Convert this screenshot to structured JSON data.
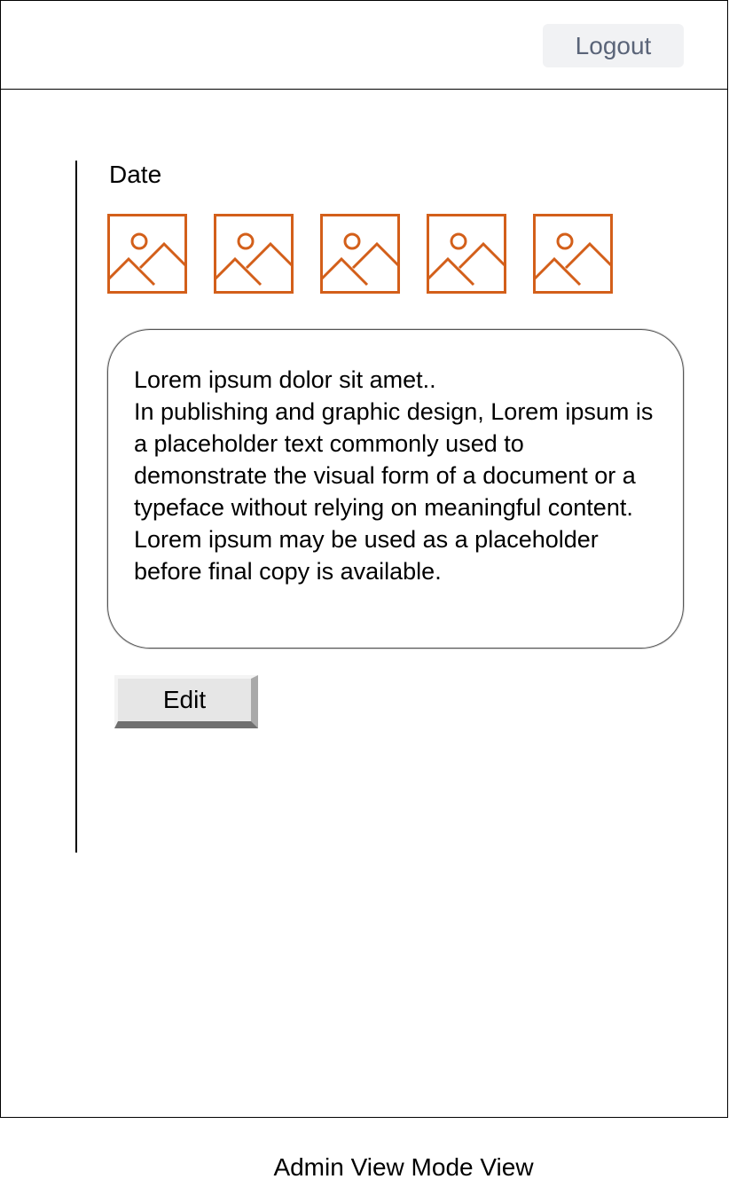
{
  "header": {
    "logout_label": "Logout"
  },
  "post": {
    "date_label": "Date",
    "images": [
      {
        "icon": "image-placeholder-icon"
      },
      {
        "icon": "image-placeholder-icon"
      },
      {
        "icon": "image-placeholder-icon"
      },
      {
        "icon": "image-placeholder-icon"
      },
      {
        "icon": "image-placeholder-icon"
      }
    ],
    "text_line1": "Lorem ipsum dolor sit amet..",
    "text_body": "In publishing and graphic design, Lorem ipsum is a placeholder text commonly used to demonstrate the visual form of a document or a typeface without relying on meaningful content. Lorem ipsum may be used as a placeholder before final copy is available.",
    "edit_label": "Edit"
  },
  "caption": "Admin View Mode View",
  "colors": {
    "accent": "#d35f1a",
    "logout_bg": "#f1f2f4",
    "logout_text": "#5a6478",
    "edit_bg": "#e6e6e6"
  }
}
